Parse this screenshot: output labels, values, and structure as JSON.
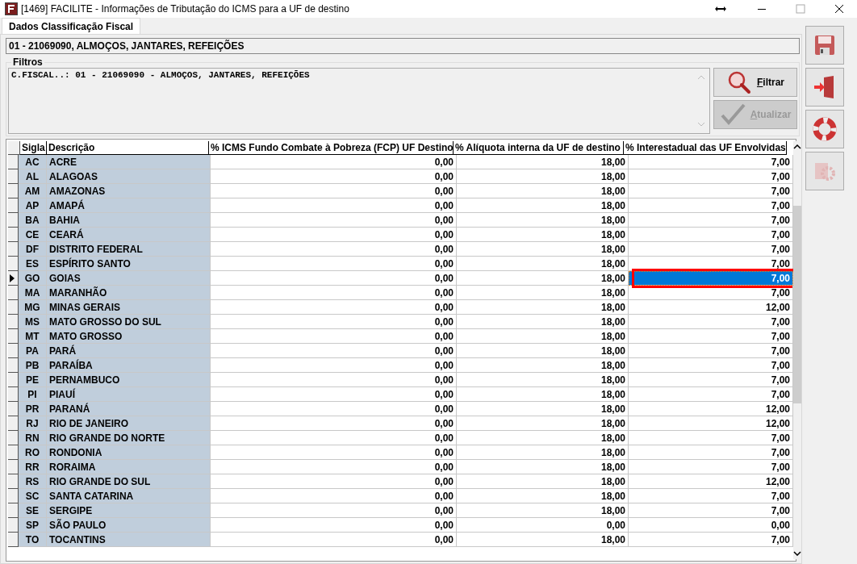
{
  "window": {
    "title": "[1469] FACILITE - Informações de Tributação do ICMS para a UF de destino"
  },
  "tabs": [
    {
      "label": "Dados Classificação Fiscal",
      "selected": true
    }
  ],
  "classification": "01 - 21069090, ALMOÇOS, JANTARES, REFEIÇÕES",
  "filters": {
    "title": "Filtros",
    "text": "C.FISCAL..: 01 - 21069090 - ALMOÇOS, JANTARES, REFEIÇÕES",
    "buttons": [
      {
        "label": "Filtrar",
        "kind": "filter",
        "disabled": false
      },
      {
        "label": "Atualizar",
        "kind": "update",
        "disabled": true
      }
    ]
  },
  "table": {
    "columns": [
      "Sigla",
      "Descrição",
      "% ICMS Fundo Combate à Pobreza (FCP) UF Destino",
      "% Alíquota interna da UF de destino",
      "% Interestadual das UF Envolvidas"
    ],
    "rows": [
      {
        "sigla": "AC",
        "name": "ACRE",
        "fcp": "0,00",
        "internal": "18,00",
        "interstate": "7,00",
        "selected": false,
        "highlighted": false
      },
      {
        "sigla": "AL",
        "name": "ALAGOAS",
        "fcp": "0,00",
        "internal": "18,00",
        "interstate": "7,00",
        "selected": false,
        "highlighted": false
      },
      {
        "sigla": "AM",
        "name": "AMAZONAS",
        "fcp": "0,00",
        "internal": "18,00",
        "interstate": "7,00",
        "selected": false,
        "highlighted": false
      },
      {
        "sigla": "AP",
        "name": "AMAPÁ",
        "fcp": "0,00",
        "internal": "18,00",
        "interstate": "7,00",
        "selected": false,
        "highlighted": false
      },
      {
        "sigla": "BA",
        "name": "BAHIA",
        "fcp": "0,00",
        "internal": "18,00",
        "interstate": "7,00",
        "selected": false,
        "highlighted": false
      },
      {
        "sigla": "CE",
        "name": "CEARÁ",
        "fcp": "0,00",
        "internal": "18,00",
        "interstate": "7,00",
        "selected": false,
        "highlighted": false
      },
      {
        "sigla": "DF",
        "name": "DISTRITO FEDERAL",
        "fcp": "0,00",
        "internal": "18,00",
        "interstate": "7,00",
        "selected": false,
        "highlighted": false
      },
      {
        "sigla": "ES",
        "name": "ESPÍRITO SANTO",
        "fcp": "0,00",
        "internal": "18,00",
        "interstate": "7,00",
        "selected": false,
        "highlighted": false
      },
      {
        "sigla": "GO",
        "name": "GOIAS",
        "fcp": "0,00",
        "internal": "18,00",
        "interstate": "7,00",
        "selected": true,
        "highlighted": true
      },
      {
        "sigla": "MA",
        "name": "MARANHÃO",
        "fcp": "0,00",
        "internal": "18,00",
        "interstate": "7,00",
        "selected": false,
        "highlighted": false
      },
      {
        "sigla": "MG",
        "name": "MINAS GERAIS",
        "fcp": "0,00",
        "internal": "18,00",
        "interstate": "12,00",
        "selected": false,
        "highlighted": false
      },
      {
        "sigla": "MS",
        "name": "MATO GROSSO DO SUL",
        "fcp": "0,00",
        "internal": "18,00",
        "interstate": "7,00",
        "selected": false,
        "highlighted": false
      },
      {
        "sigla": "MT",
        "name": "MATO GROSSO",
        "fcp": "0,00",
        "internal": "18,00",
        "interstate": "7,00",
        "selected": false,
        "highlighted": false
      },
      {
        "sigla": "PA",
        "name": "PARÁ",
        "fcp": "0,00",
        "internal": "18,00",
        "interstate": "7,00",
        "selected": false,
        "highlighted": false
      },
      {
        "sigla": "PB",
        "name": "PARAÍBA",
        "fcp": "0,00",
        "internal": "18,00",
        "interstate": "7,00",
        "selected": false,
        "highlighted": false
      },
      {
        "sigla": "PE",
        "name": "PERNAMBUCO",
        "fcp": "0,00",
        "internal": "18,00",
        "interstate": "7,00",
        "selected": false,
        "highlighted": false
      },
      {
        "sigla": "PI",
        "name": "PIAUÍ",
        "fcp": "0,00",
        "internal": "18,00",
        "interstate": "7,00",
        "selected": false,
        "highlighted": false
      },
      {
        "sigla": "PR",
        "name": "PARANÁ",
        "fcp": "0,00",
        "internal": "18,00",
        "interstate": "12,00",
        "selected": false,
        "highlighted": false
      },
      {
        "sigla": "RJ",
        "name": "RIO DE JANEIRO",
        "fcp": "0,00",
        "internal": "18,00",
        "interstate": "12,00",
        "selected": false,
        "highlighted": false
      },
      {
        "sigla": "RN",
        "name": "RIO GRANDE DO NORTE",
        "fcp": "0,00",
        "internal": "18,00",
        "interstate": "7,00",
        "selected": false,
        "highlighted": false
      },
      {
        "sigla": "RO",
        "name": "RONDONIA",
        "fcp": "0,00",
        "internal": "18,00",
        "interstate": "7,00",
        "selected": false,
        "highlighted": false
      },
      {
        "sigla": "RR",
        "name": "RORAIMA",
        "fcp": "0,00",
        "internal": "18,00",
        "interstate": "7,00",
        "selected": false,
        "highlighted": false
      },
      {
        "sigla": "RS",
        "name": "RIO GRANDE DO SUL",
        "fcp": "0,00",
        "internal": "18,00",
        "interstate": "12,00",
        "selected": false,
        "highlighted": false
      },
      {
        "sigla": "SC",
        "name": "SANTA CATARINA",
        "fcp": "0,00",
        "internal": "18,00",
        "interstate": "7,00",
        "selected": false,
        "highlighted": false
      },
      {
        "sigla": "SE",
        "name": "SERGIPE",
        "fcp": "0,00",
        "internal": "18,00",
        "interstate": "7,00",
        "selected": false,
        "highlighted": false
      },
      {
        "sigla": "SP",
        "name": "SÃO PAULO",
        "fcp": "0,00",
        "internal": "0,00",
        "interstate": "0,00",
        "selected": false,
        "highlighted": false
      },
      {
        "sigla": "TO",
        "name": "TOCANTINS",
        "fcp": "0,00",
        "internal": "18,00",
        "interstate": "7,00",
        "selected": false,
        "highlighted": false
      }
    ]
  },
  "toolbar": [
    {
      "kind": "save",
      "disabled": false
    },
    {
      "kind": "exit",
      "disabled": false
    },
    {
      "kind": "help",
      "disabled": false
    },
    {
      "kind": "settings",
      "disabled": true
    }
  ]
}
